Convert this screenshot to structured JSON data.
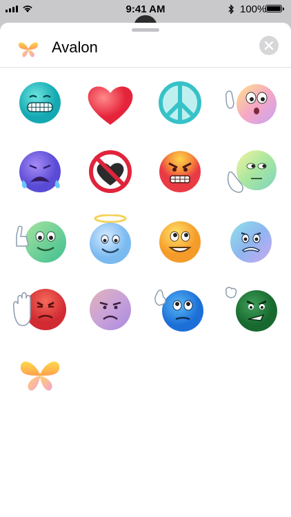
{
  "status_bar": {
    "time": "9:41 AM",
    "battery": "100%",
    "icons": [
      "signal-bars-icon",
      "wifi-icon",
      "bluetooth-icon",
      "battery-icon"
    ]
  },
  "sheet": {
    "app_name": "Avalon",
    "app_icon": "butterfly-icon",
    "close_icon": "close-icon"
  },
  "stickers": [
    {
      "name": "grinning-teal-face-sticker"
    },
    {
      "name": "red-heart-sticker"
    },
    {
      "name": "peace-sign-sticker"
    },
    {
      "name": "waving-surprised-face-sticker"
    },
    {
      "name": "crying-purple-face-sticker"
    },
    {
      "name": "no-broken-heart-sticker"
    },
    {
      "name": "angry-orange-face-sticker"
    },
    {
      "name": "face-palm-green-sticker"
    },
    {
      "name": "thumbs-up-green-face-sticker"
    },
    {
      "name": "angel-blue-face-sticker"
    },
    {
      "name": "smiling-yellow-face-sticker"
    },
    {
      "name": "worried-blue-face-sticker"
    },
    {
      "name": "stop-hand-red-face-sticker"
    },
    {
      "name": "frowning-pink-face-sticker"
    },
    {
      "name": "thinking-blue-face-sticker"
    },
    {
      "name": "fist-angry-green-face-sticker"
    },
    {
      "name": "butterfly-sticker"
    }
  ],
  "colors": {
    "sheet_background": "#ffffff",
    "backdrop": "#c9c9cc",
    "close_button": "#d7d7da",
    "divider": "#e2e2e4"
  }
}
